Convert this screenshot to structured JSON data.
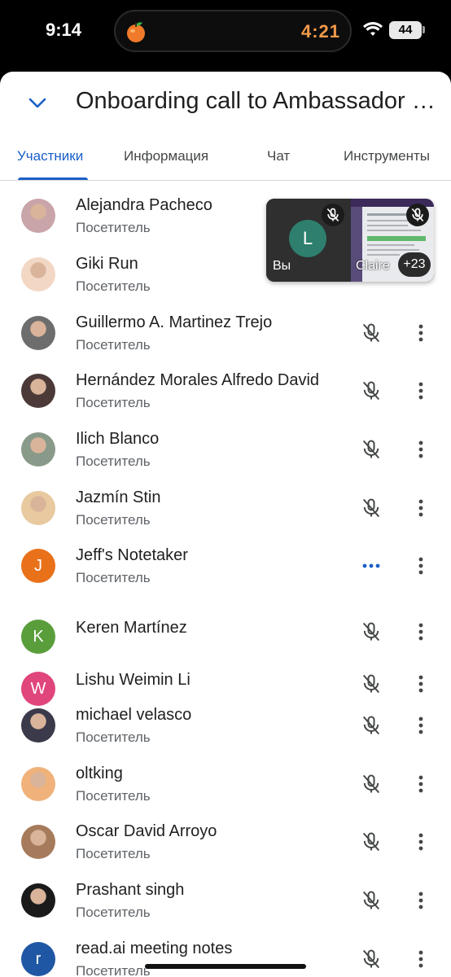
{
  "status_bar": {
    "time": "9:14",
    "timer": "4:21",
    "battery": "44"
  },
  "header": {
    "title": "Onboarding call to Ambassador Pr..."
  },
  "tabs": [
    {
      "label": "Участники",
      "active": true
    },
    {
      "label": "Информация",
      "active": false
    },
    {
      "label": "Чат",
      "active": false
    },
    {
      "label": "Инструменты",
      "active": false
    }
  ],
  "pip": {
    "self_initial": "L",
    "self_label": "Вы",
    "other_label": "Claire",
    "others_count": "+23"
  },
  "participants": [
    {
      "name": "Alejandra Pacheco",
      "role": "Посетитель",
      "avatar": "photo"
    },
    {
      "name": "Giki Run",
      "role": "Посетитель",
      "avatar": "photo"
    },
    {
      "name": "Guillermo A. Martinez Trejo",
      "role": "Посетитель",
      "avatar": "photo"
    },
    {
      "name": "Hernández Morales Alfredo David",
      "role": "Посетитель",
      "avatar": "photo"
    },
    {
      "name": "Ilich Blanco",
      "role": "Посетитель",
      "avatar": "photo"
    },
    {
      "name": "Jazmín Stin",
      "role": "Посетитель",
      "avatar": "photo"
    },
    {
      "name": "Jeff's Notetaker",
      "role": "Посетитель",
      "initial": "J",
      "color": "#e8711a"
    },
    {
      "name": "Keren Martínez",
      "role": "",
      "initial": "K",
      "color": "#5a9e3c"
    },
    {
      "name": "Lishu Weimin Li",
      "role": "",
      "initial": "W",
      "color": "#e0457b"
    },
    {
      "name": "michael velasco",
      "role": "Посетитель",
      "avatar": "photo"
    },
    {
      "name": "oltking",
      "role": "Посетитель",
      "avatar": "photo"
    },
    {
      "name": "Oscar David Arroyo",
      "role": "Посетитель",
      "avatar": "photo"
    },
    {
      "name": "Prashant singh",
      "role": "Посетитель",
      "avatar": "photo"
    },
    {
      "name": "read.ai meeting notes",
      "role": "Посетитель",
      "initial": "r",
      "color": "#1f57a4"
    }
  ],
  "colors": {
    "accent": "#1a5fc8",
    "text": "#1f1f1f",
    "secondary": "#5f6368"
  }
}
